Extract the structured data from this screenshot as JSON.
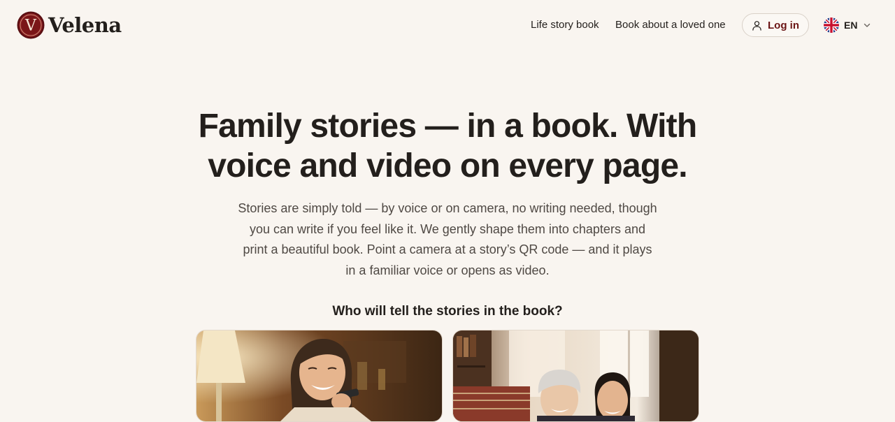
{
  "brand": {
    "name": "Velena",
    "monogram": "V",
    "color": "#7a1618"
  },
  "nav": {
    "life_story": "Life story book",
    "loved_one": "Book about a loved one",
    "login": "Log in",
    "language": "EN"
  },
  "hero": {
    "title": "Family stories — in a book. With voice and video on every page.",
    "subtitle": "Stories are simply told — by voice or on camera, no writing needed, though you can write if you feel like it. We gently shape them into chapters and print a beautiful book. Point a camera at a story’s QR code — and it plays in a familiar voice or opens as video.",
    "question": "Who will tell the stories in the book?"
  },
  "cards": [
    {
      "image": "woman-recording-voice-message-photo"
    },
    {
      "image": "grandmother-and-daughter-photo"
    }
  ],
  "colors": {
    "background": "#f9f5f0",
    "text": "#231f1c",
    "muted_text": "#4f4944",
    "accent": "#6b1515"
  }
}
